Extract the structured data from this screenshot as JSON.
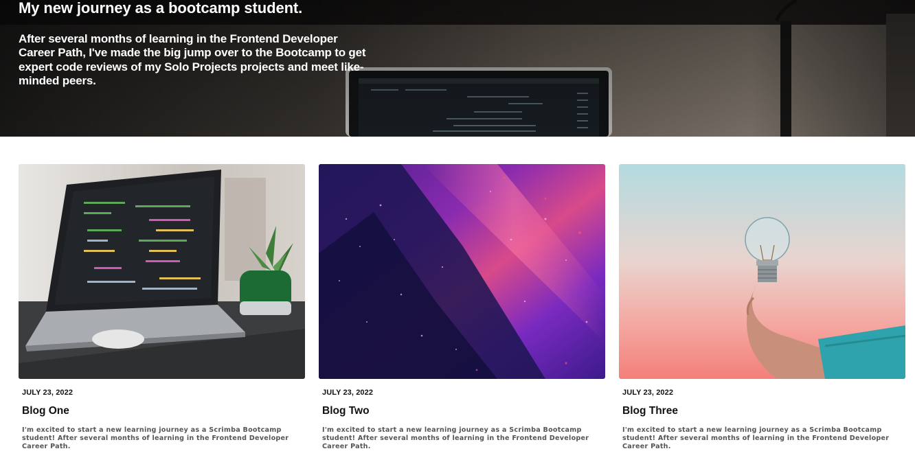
{
  "hero": {
    "title": "My new journey as a bootcamp student.",
    "description": "After several months of learning in the Frontend Developer Career Path, I've made the big jump over to the Bootcamp to get expert code reviews of my Solo Projects projects and meet like-minded peers."
  },
  "posts": [
    {
      "date": "JULY 23, 2022",
      "title": "Blog One",
      "excerpt": "I'm excited to start a new learning journey as a Scrimba Bootcamp student! After several months of learning in the Frontend Developer Career Path."
    },
    {
      "date": "JULY 23, 2022",
      "title": "Blog Two",
      "excerpt": "I'm excited to start a new learning journey as a Scrimba Bootcamp student! After several months of learning in the Frontend Developer Career Path."
    },
    {
      "date": "JULY 23, 2022",
      "title": "Blog Three",
      "excerpt": "I'm excited to start a new learning journey as a Scrimba Bootcamp student! After several months of learning in the Frontend Developer Career Path."
    }
  ],
  "colors": {
    "hero_text": "#ffffff",
    "heading_text": "#111111",
    "excerpt_text": "#555555"
  }
}
